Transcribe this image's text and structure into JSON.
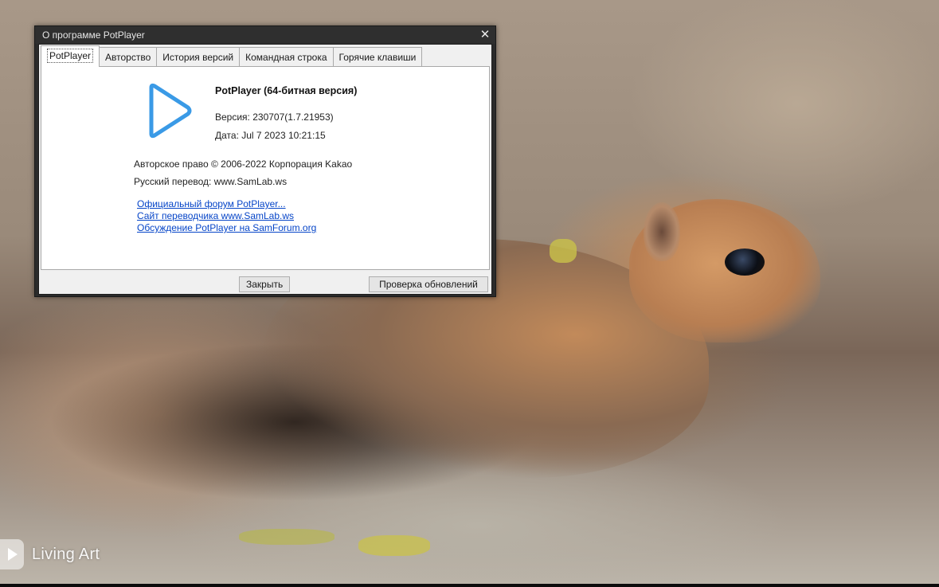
{
  "dialog": {
    "title": "О программе PotPlayer",
    "close_symbol": "✕",
    "tabs": [
      {
        "label": "PotPlayer",
        "active": true
      },
      {
        "label": "Авторство",
        "active": false
      },
      {
        "label": "История версий",
        "active": false
      },
      {
        "label": "Командная строка",
        "active": false
      },
      {
        "label": "Горячие клавиши",
        "active": false
      }
    ],
    "about": {
      "app_name": "PotPlayer (64-битная версия)",
      "version": "Версия: 230707(1.7.21953)",
      "date": "Дата: Jul  7 2023 10:21:15",
      "copyright": "Авторское право © 2006-2022 Корпорация Kakao",
      "translation": "Русский перевод: www.SamLab.ws",
      "links": [
        "Официальный форум PotPlayer...",
        "Сайт переводчика www.SamLab.ws",
        "Обсуждение PotPlayer на SamForum.org"
      ]
    },
    "buttons": {
      "close": "Закрыть",
      "check_updates": "Проверка обновлений"
    },
    "icons": {
      "logo": "potplayer-play-logo-icon",
      "close": "close-icon"
    },
    "colors": {
      "logo_blue": "#3a9ae6",
      "link_blue": "#0645c8",
      "titlebar": "#2f2f2f"
    }
  },
  "video": {
    "watermark": "Living Art"
  }
}
